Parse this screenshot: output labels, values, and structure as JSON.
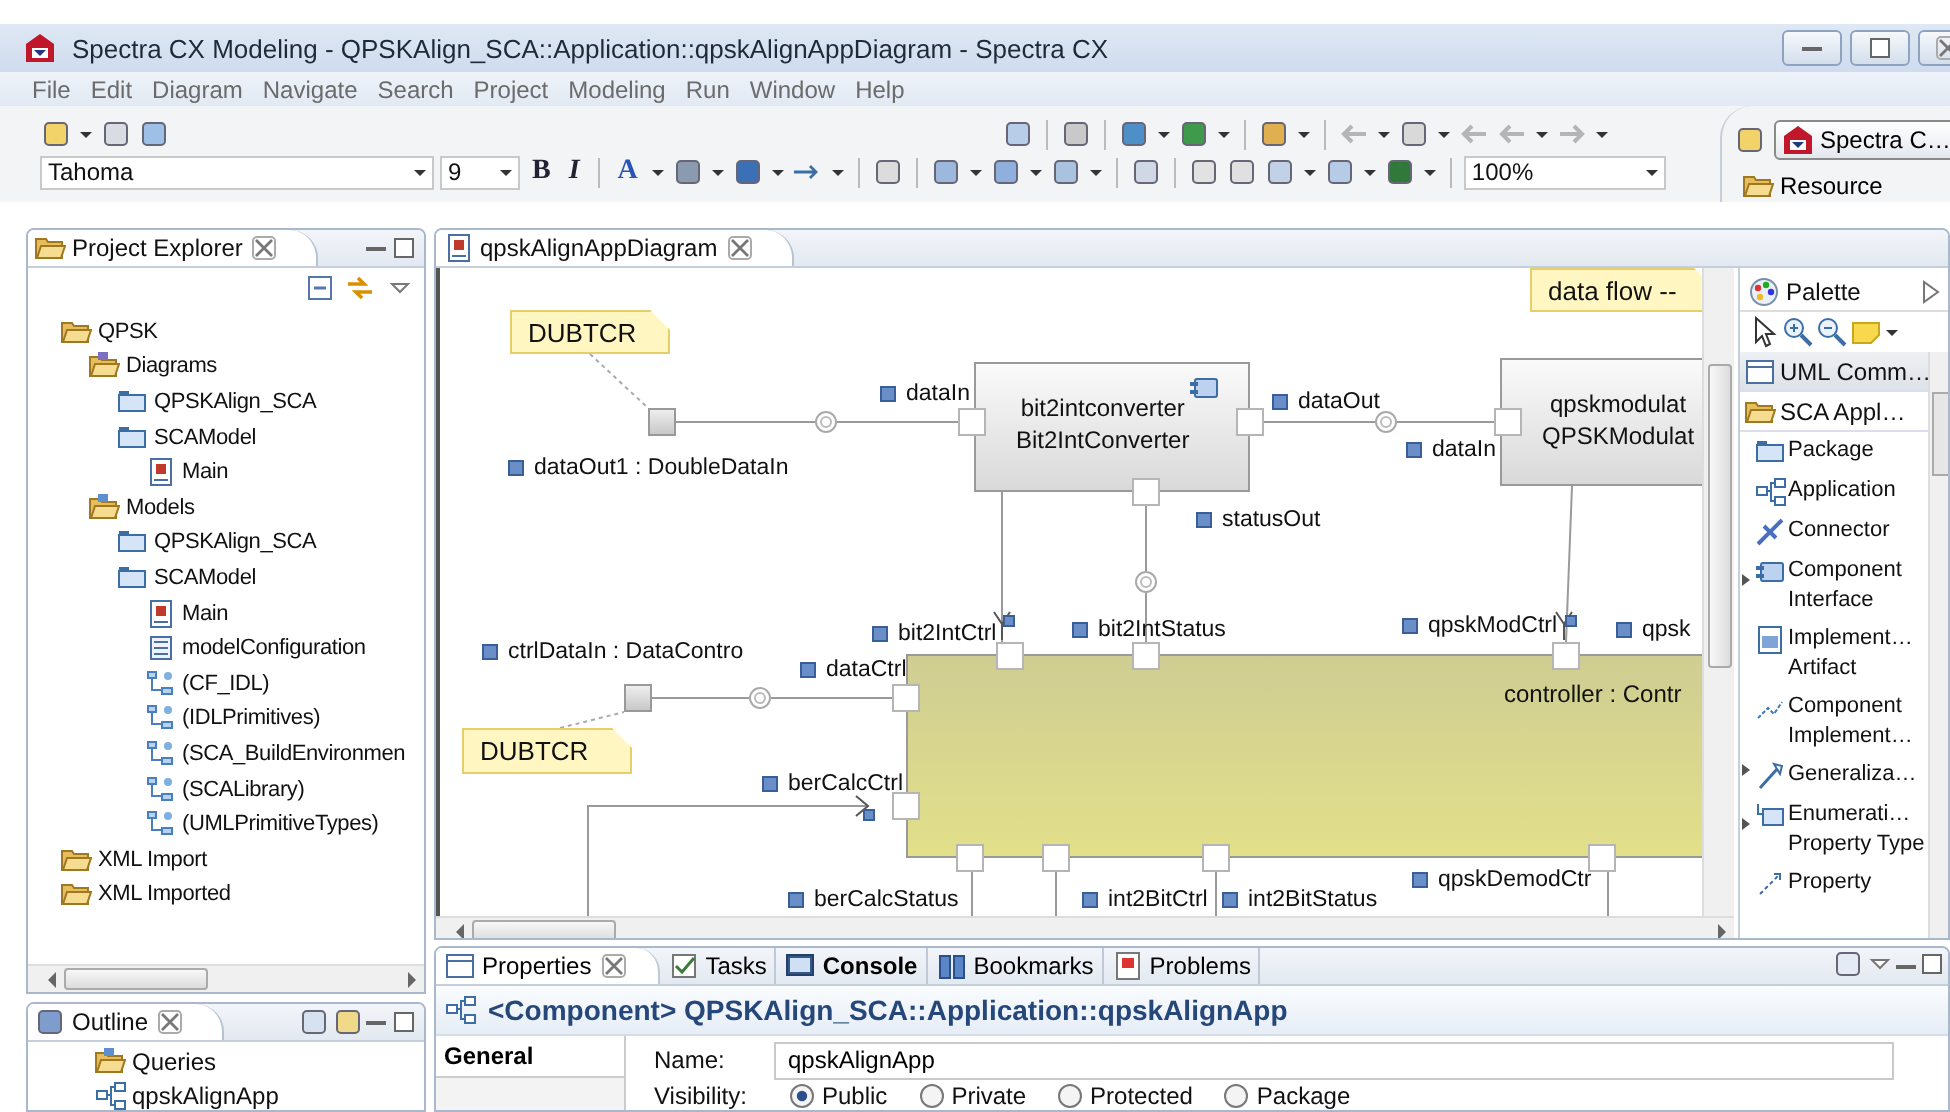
{
  "window": {
    "title": "Spectra CX Modeling - QPSKAlign_SCA::Application::qpskAlignAppDiagram - Spectra CX"
  },
  "menu": [
    "File",
    "Edit",
    "Diagram",
    "Navigate",
    "Search",
    "Project",
    "Modeling",
    "Run",
    "Window",
    "Help"
  ],
  "toolbar": {
    "font": "Tahoma",
    "font_size": "9",
    "zoom": "100%",
    "format_buttons": [
      {
        "label": "B",
        "kind": "bold"
      },
      {
        "label": "I",
        "kind": "italic"
      },
      {
        "label": "A",
        "kind": "font-color"
      }
    ]
  },
  "perspectives": [
    {
      "label": "Spectra C…",
      "selected": true
    },
    {
      "label": "Resource",
      "selected": false
    }
  ],
  "project_explorer": {
    "title": "Project Explorer",
    "tree": [
      {
        "label": "QPSK",
        "kind": "folder",
        "children": [
          {
            "label": "Diagrams",
            "kind": "diagrams",
            "children": [
              {
                "label": "QPSKAlign_SCA",
                "kind": "package"
              },
              {
                "label": "SCAModel",
                "kind": "package",
                "children": [
                  {
                    "label": "Main",
                    "kind": "diagram"
                  }
                ]
              }
            ]
          },
          {
            "label": "Models",
            "kind": "models",
            "children": [
              {
                "label": "QPSKAlign_SCA",
                "kind": "package"
              },
              {
                "label": "SCAModel",
                "kind": "package",
                "children": [
                  {
                    "label": "Main",
                    "kind": "diagram"
                  },
                  {
                    "label": "modelConfiguration",
                    "kind": "config"
                  },
                  {
                    "label": "(CF_IDL)",
                    "kind": "import"
                  },
                  {
                    "label": "(IDLPrimitives)",
                    "kind": "import"
                  },
                  {
                    "label": "(SCA_BuildEnvironmen",
                    "kind": "import"
                  },
                  {
                    "label": "(SCALibrary)",
                    "kind": "import"
                  },
                  {
                    "label": "(UMLPrimitiveTypes)",
                    "kind": "import"
                  }
                ]
              }
            ]
          }
        ]
      },
      {
        "label": "XML Import",
        "kind": "folder"
      },
      {
        "label": "XML Imported",
        "kind": "folder"
      }
    ]
  },
  "outline": {
    "title": "Outline",
    "items": [
      {
        "label": "Queries",
        "kind": "models"
      },
      {
        "label": "qpskAlignApp",
        "kind": "application"
      }
    ]
  },
  "editor": {
    "tab": "qpskAlignAppDiagram",
    "notes": [
      "DUBTCR",
      "DUBTCR",
      "data flow --"
    ],
    "components": [
      {
        "kind": "component",
        "name": "bit2intconverter",
        "type": "Bit2IntConverter"
      },
      {
        "kind": "component",
        "name": "qpskmodulat",
        "type": "QPSKModulat"
      },
      {
        "kind": "controller",
        "name": "controller : Contr"
      }
    ],
    "port_labels": [
      "dataIn",
      "dataOut1 : DoubleDataIn",
      "dataOut",
      "dataIn",
      "statusOut",
      "bit2IntCtrl",
      "bit2IntStatus",
      "qpskModCtrl",
      "qpsk",
      "ctrlDataIn : DataContro",
      "dataCtrl",
      "berCalcCtrl",
      "qpskDemodCtr",
      "berCalcStatus",
      "int2BitCtrl",
      "int2BitStatus"
    ]
  },
  "palette": {
    "title": "Palette",
    "drawers": [
      {
        "label": "UML Comm…",
        "expanded": false
      },
      {
        "label": "SCA Appl…",
        "expanded": true
      }
    ],
    "tools": [
      {
        "label": "Package",
        "kind": "package",
        "stack": false
      },
      {
        "label": "Application",
        "kind": "application",
        "stack": false
      },
      {
        "label": "Connector",
        "kind": "connector",
        "stack": false
      },
      {
        "label": "Component Interface",
        "kind": "interface",
        "stack": true
      },
      {
        "label": "Implement… Artifact",
        "kind": "artifact",
        "stack": false
      },
      {
        "label": "Component Implement…",
        "kind": "implementation",
        "stack": false
      },
      {
        "label": "Generaliza…",
        "kind": "generalization",
        "stack": true
      },
      {
        "label": "Enumerati… Property Type",
        "kind": "enumeration",
        "stack": true
      },
      {
        "label": "Property",
        "kind": "property",
        "stack": false
      }
    ]
  },
  "properties": {
    "tabs": [
      {
        "label": "Properties",
        "kind": "properties",
        "selected": true,
        "bold": false
      },
      {
        "label": "Tasks",
        "kind": "tasks",
        "selected": false,
        "bold": false
      },
      {
        "label": "Console",
        "kind": "console",
        "selected": false,
        "bold": true
      },
      {
        "label": "Bookmarks",
        "kind": "bookmarks",
        "selected": false,
        "bold": false
      },
      {
        "label": "Problems",
        "kind": "problems",
        "selected": false,
        "bold": false
      }
    ],
    "header": "<Component> QPSKAlign_SCA::Application::qpskAlignApp",
    "sections": [
      {
        "label": "General",
        "selected": true
      }
    ],
    "name": {
      "label": "Name:",
      "value": "qpskAlignApp"
    },
    "visibility": {
      "label": "Visibility:",
      "options": [
        {
          "label": "Public",
          "selected": true
        },
        {
          "label": "Private",
          "selected": false
        },
        {
          "label": "Protected",
          "selected": false
        },
        {
          "label": "Package",
          "selected": false
        }
      ]
    }
  }
}
